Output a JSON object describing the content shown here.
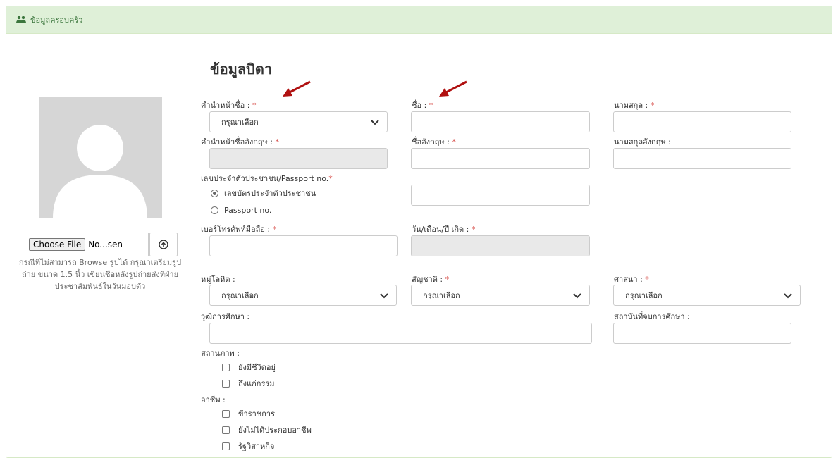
{
  "header": {
    "title": "ข้อมูลครอบครัว",
    "icon": "users-icon"
  },
  "photo": {
    "choose_label": "Choose File",
    "file_name": "No...sen",
    "hint": "กรณีที่ไม่สามารถ Browse รูปได้ กรุณาเตรียมรูปถ่าย ขนาด 1.5 นิ้ว เขียนชื่อหลังรูปถ่ายส่งที่ฝ่ายประชาสัมพันธ์ในวันมอบตัว"
  },
  "section_title": "ข้อมูลบิดา",
  "labels": {
    "prefix": "คำนำหน้าชื่อ :",
    "first_name": "ชื่อ :",
    "last_name": "นามสกุล :",
    "prefix_en": "คำนำหน้าชื่ออังกฤษ :",
    "first_name_en": "ชื่ออังกฤษ :",
    "last_name_en": "นามสกุลอังกฤษ :",
    "id_type": "เลขประจำตัวประชาชน/Passport no.",
    "phone": "เบอร์โทรศัพท์มือถือ :",
    "birthdate": "วัน/เดือน/ปี เกิด :",
    "blood": "หมู่โลหิต :",
    "nationality": "สัญชาติ :",
    "religion": "ศาสนา :",
    "education": "วุฒิการศึกษา :",
    "institution": "สถาบันที่จบการศึกษา :",
    "status": "สถานภาพ :",
    "occupation": "อาชีพ :",
    "required_mark": "*"
  },
  "selects": {
    "prefix": "กรุณาเลือก",
    "blood": "กรุณาเลือก",
    "nationality": "กรุณาเลือก",
    "religion": "กรุณาเลือก"
  },
  "id_options": [
    {
      "label": "เลขบัตรประจำตัวประชาชน",
      "checked": true
    },
    {
      "label": "Passport no.",
      "checked": false
    }
  ],
  "status_options": [
    "ยังมีชีวิตอยู่",
    "ถึงแก่กรรม"
  ],
  "occupation_options": [
    "ข้าราชการ",
    "ยังไม่ได้ประกอบอาชีพ",
    "รัฐวิสาหกิจ"
  ],
  "colors": {
    "required": "#d9534f",
    "header_bg": "#dff0d8",
    "arrow": "#b01010"
  }
}
